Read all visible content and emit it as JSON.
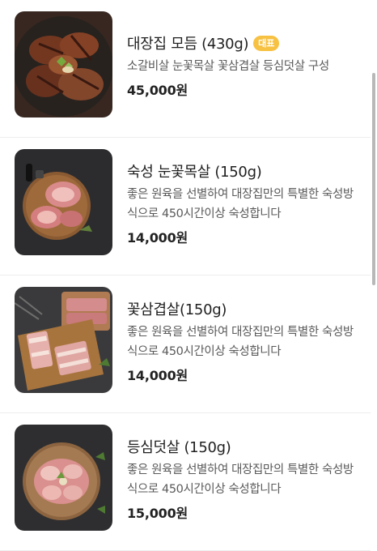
{
  "menu": {
    "items": [
      {
        "name": "대장집 모듬 (430g)",
        "badge": "대표",
        "description": "소갈비살 눈꽃목살 꽃삼겹살 등심덧살 구성",
        "price": "45,000원",
        "image": "assorted-grilled-meat-photo"
      },
      {
        "name": "숙성 눈꽃목살 (150g)",
        "badge": "",
        "description": "좋은 원육을 선별하여 대장집만의 특별한 숙성방식으로 450시간이상 숙성합니다",
        "price": "14,000원",
        "image": "raw-pork-neck-on-wood-board-photo"
      },
      {
        "name": "꽃삼겹살(150g)",
        "badge": "",
        "description": "좋은 원육을 선별하여 대장집만의 특별한 숙성방식으로 450시간이상 숙성합니다",
        "price": "14,000원",
        "image": "raw-pork-belly-on-wood-board-photo"
      },
      {
        "name": "등심덧살 (150g)",
        "badge": "",
        "description": "좋은 원육을 선별하여 대장집만의 특별한 숙성방식으로 450시간이상 숙성합니다",
        "price": "15,000원",
        "image": "raw-pork-loin-on-wood-board-photo"
      }
    ]
  },
  "colors": {
    "badge": "#f7c142",
    "text": "#1f1f1f",
    "description": "#5a5a5a"
  }
}
